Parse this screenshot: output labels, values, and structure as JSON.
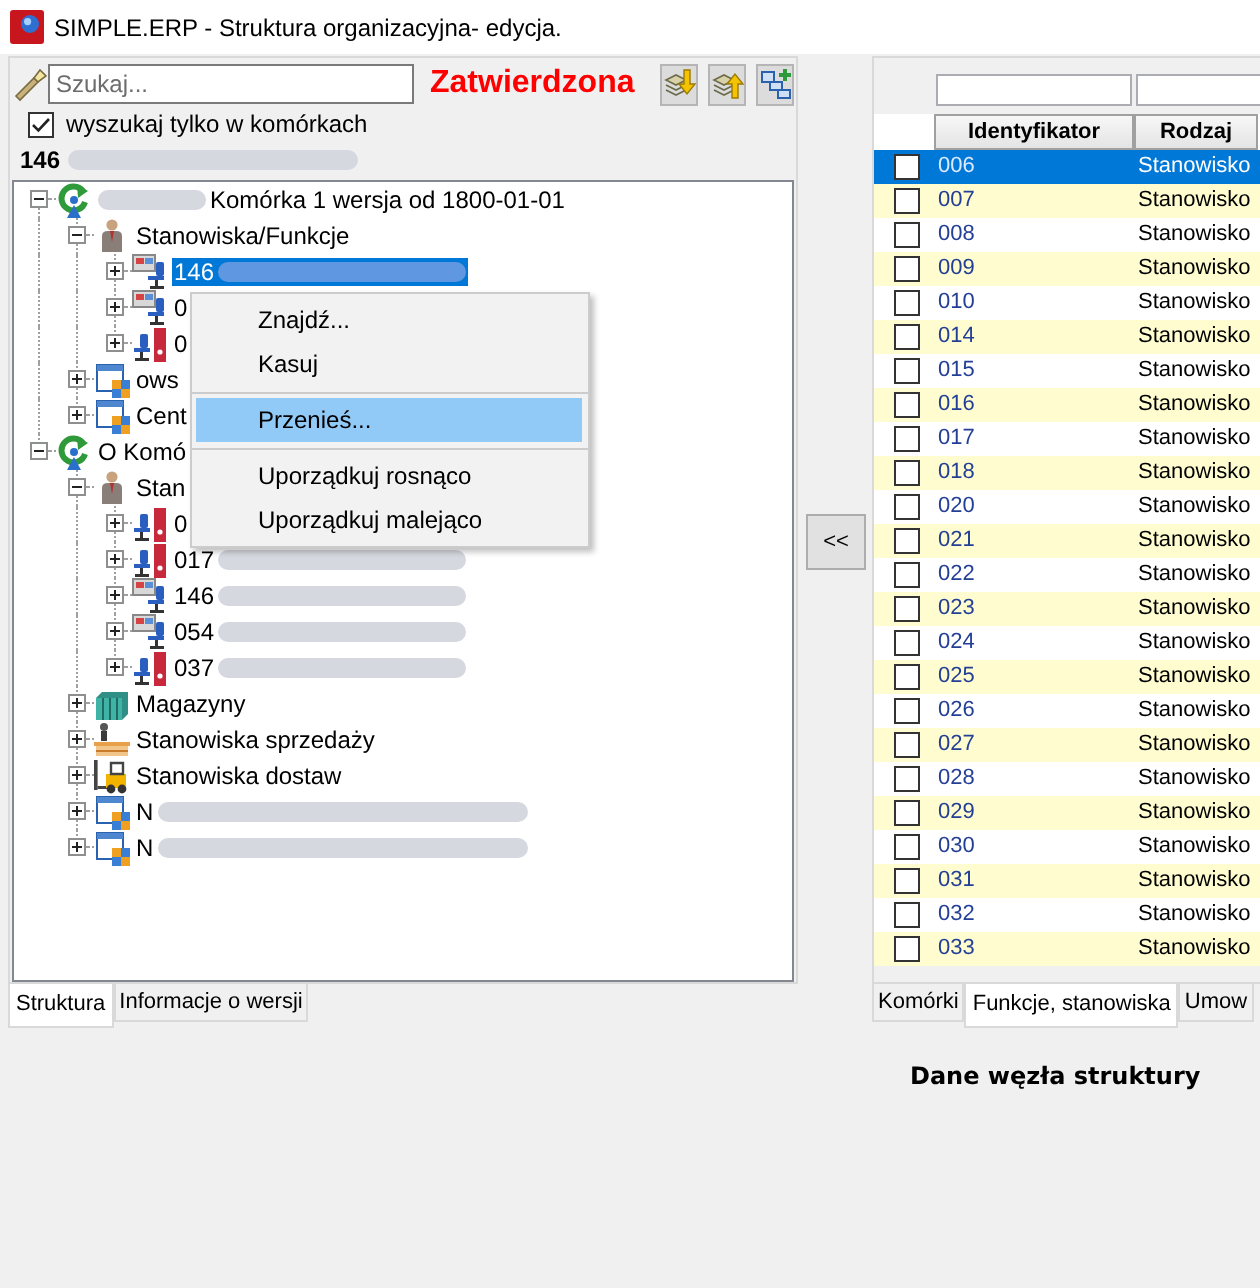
{
  "window": {
    "title": "SIMPLE.ERP - Struktura organizacyjna- edycja."
  },
  "structure_panel": {
    "search": {
      "placeholder": "Szukaj..."
    },
    "status": "Zatwierdzona",
    "search_only_cells": {
      "label": "wyszukaj tylko w komórkach",
      "checked": true
    },
    "current_node": {
      "label": "146",
      "redacted_suffix": true
    },
    "tree": [
      {
        "label": "Komórka 1 wersja od 1800-01-01",
        "kind": "cell",
        "redacted_prefix": true,
        "expanded": true,
        "selected": false,
        "children": [
          {
            "label": "Stanowiska/Funkcje",
            "kind": "group",
            "expanded": true,
            "selected": false,
            "children": [
              {
                "label": "146",
                "kind": "position",
                "redacted_suffix": true,
                "expanded": false,
                "selected": true
              },
              {
                "label": "0",
                "kind": "position",
                "expanded": false,
                "selected": false
              },
              {
                "label": "0",
                "kind": "position_file",
                "expanded": false,
                "selected": false
              }
            ]
          },
          {
            "label": "ows",
            "kind": "unit",
            "expanded": false,
            "selected": false
          },
          {
            "label": "Cent",
            "kind": "unit",
            "expanded": false,
            "selected": false
          }
        ]
      },
      {
        "label": "O Komó",
        "kind": "cell",
        "expanded": true,
        "selected": false,
        "children": [
          {
            "label": "Stan",
            "kind": "group",
            "expanded": true,
            "selected": false,
            "children": [
              {
                "label": "0",
                "kind": "position_file",
                "expanded": false,
                "selected": false
              },
              {
                "label": "017",
                "kind": "position_file",
                "redacted_suffix": true,
                "expanded": false,
                "selected": false
              },
              {
                "label": "146",
                "kind": "position",
                "redacted_suffix": true,
                "expanded": false,
                "selected": false
              },
              {
                "label": "054",
                "kind": "position",
                "redacted_suffix": true,
                "expanded": false,
                "selected": false
              },
              {
                "label": "037",
                "kind": "position_file",
                "redacted_suffix": true,
                "expanded": false,
                "selected": false
              }
            ]
          },
          {
            "label": "Magazyny",
            "kind": "warehouse",
            "expanded": false,
            "selected": false
          },
          {
            "label": "Stanowiska sprzedaży",
            "kind": "sales",
            "expanded": false,
            "selected": false
          },
          {
            "label": "Stanowiska dostaw",
            "kind": "delivery",
            "expanded": false,
            "selected": false
          },
          {
            "label": "N",
            "kind": "unit",
            "redacted_suffix": true,
            "expanded": false,
            "selected": false
          },
          {
            "label": "N",
            "kind": "unit",
            "redacted_suffix": true,
            "expanded": false,
            "selected": false
          }
        ]
      }
    ],
    "context_menu": {
      "groups": [
        [
          {
            "label": "Znajdź...",
            "selected": false
          },
          {
            "label": "Kasuj",
            "selected": false
          }
        ],
        [
          {
            "label": "Przenieś...",
            "selected": true
          }
        ],
        [
          {
            "label": "Uporządkuj rosnąco",
            "selected": false
          },
          {
            "label": "Uporządkuj malejąco",
            "selected": false
          }
        ]
      ]
    },
    "tabs": [
      {
        "label": "Struktura",
        "selected": true
      },
      {
        "label": "Informacje o wersji",
        "selected": false
      }
    ]
  },
  "move_button": {
    "label": "<<"
  },
  "positions_panel": {
    "columns": [
      "Identyfikator",
      "Rodzaj"
    ],
    "rows": [
      {
        "id": "006",
        "type": "Stanowisko",
        "checked": false,
        "selected": true
      },
      {
        "id": "007",
        "type": "Stanowisko",
        "checked": false,
        "selected": false
      },
      {
        "id": "008",
        "type": "Stanowisko",
        "checked": false,
        "selected": false
      },
      {
        "id": "009",
        "type": "Stanowisko",
        "checked": false,
        "selected": false
      },
      {
        "id": "010",
        "type": "Stanowisko",
        "checked": false,
        "selected": false
      },
      {
        "id": "014",
        "type": "Stanowisko",
        "checked": false,
        "selected": false
      },
      {
        "id": "015",
        "type": "Stanowisko",
        "checked": false,
        "selected": false
      },
      {
        "id": "016",
        "type": "Stanowisko",
        "checked": false,
        "selected": false
      },
      {
        "id": "017",
        "type": "Stanowisko",
        "checked": false,
        "selected": false
      },
      {
        "id": "018",
        "type": "Stanowisko",
        "checked": false,
        "selected": false
      },
      {
        "id": "020",
        "type": "Stanowisko",
        "checked": false,
        "selected": false
      },
      {
        "id": "021",
        "type": "Stanowisko",
        "checked": false,
        "selected": false
      },
      {
        "id": "022",
        "type": "Stanowisko",
        "checked": false,
        "selected": false
      },
      {
        "id": "023",
        "type": "Stanowisko",
        "checked": false,
        "selected": false
      },
      {
        "id": "024",
        "type": "Stanowisko",
        "checked": false,
        "selected": false
      },
      {
        "id": "025",
        "type": "Stanowisko",
        "checked": false,
        "selected": false
      },
      {
        "id": "026",
        "type": "Stanowisko",
        "checked": false,
        "selected": false
      },
      {
        "id": "027",
        "type": "Stanowisko",
        "checked": false,
        "selected": false
      },
      {
        "id": "028",
        "type": "Stanowisko",
        "checked": false,
        "selected": false
      },
      {
        "id": "029",
        "type": "Stanowisko",
        "checked": false,
        "selected": false
      },
      {
        "id": "030",
        "type": "Stanowisko",
        "checked": false,
        "selected": false
      },
      {
        "id": "031",
        "type": "Stanowisko",
        "checked": false,
        "selected": false
      },
      {
        "id": "032",
        "type": "Stanowisko",
        "checked": false,
        "selected": false
      },
      {
        "id": "033",
        "type": "Stanowisko",
        "checked": false,
        "selected": false
      }
    ],
    "tabs": [
      {
        "label": "Komórki",
        "selected": false
      },
      {
        "label": "Funkcje, stanowiska",
        "selected": true
      },
      {
        "label": "Umow",
        "selected": false
      }
    ]
  },
  "details_title": "Dane węzła struktury"
}
